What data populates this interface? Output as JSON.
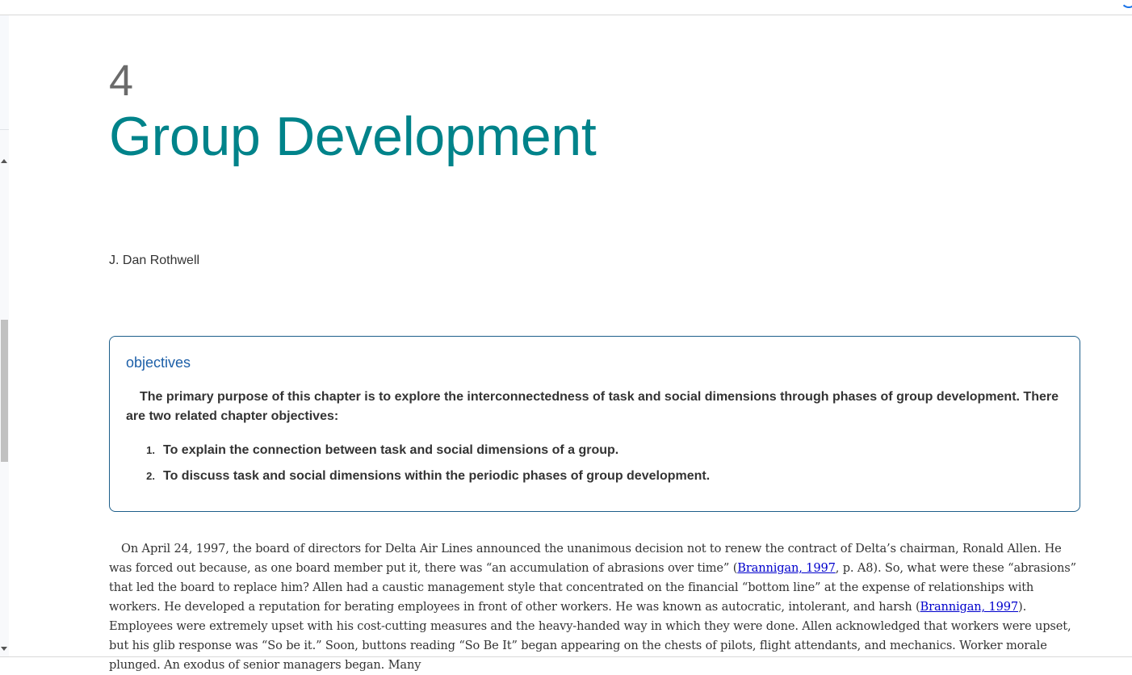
{
  "chapter": {
    "number": "4",
    "title": "Group Development",
    "author": "J. Dan Rothwell"
  },
  "objectives": {
    "heading": "objectives",
    "intro": "The primary purpose of this chapter is to explore the interconnectedness of task and social dimensions through phases of group development. There are two related chapter objectives:",
    "items": [
      {
        "num": "1.",
        "text": "To explain the connection between task and social dimensions of a group."
      },
      {
        "num": "2.",
        "text": "To discuss task and social dimensions within the periodic phases of group development."
      }
    ]
  },
  "body": {
    "p1_a": "On April 24, 1997, the board of directors for Delta Air Lines announced the unanimous decision not to renew the contract of Delta’s chairman, Ronald Allen. He was forced out because, as one board member put it, there was “an accumulation of abrasions over time” (",
    "link1": "Brannigan, 1997",
    "p1_b": ", p. A8). So, what were these “abrasions” that led the board to replace him? Allen had a caustic management style that concentrated on the financial “bottom line” at the expense of relationships with workers. He developed a reputation for berating employees in front of other workers. He was known as autocratic, intolerant, and harsh (",
    "link2": "Brannigan, 1997",
    "p1_c": "). Employees were extremely upset with his cost-cutting measures and the heavy-handed way in which they were done. Allen acknowledged that workers were upset, but his glib response was “So be it.” Soon, buttons reading “So Be It” began appearing on the chests of pilots, flight attendants, and mechanics. Worker morale plunged. An exodus of senior managers began. Many"
  },
  "colors": {
    "title": "#00838a",
    "objectives_heading": "#1c5fa8",
    "box_border": "#1d5e8a",
    "link": "#0000cc"
  }
}
